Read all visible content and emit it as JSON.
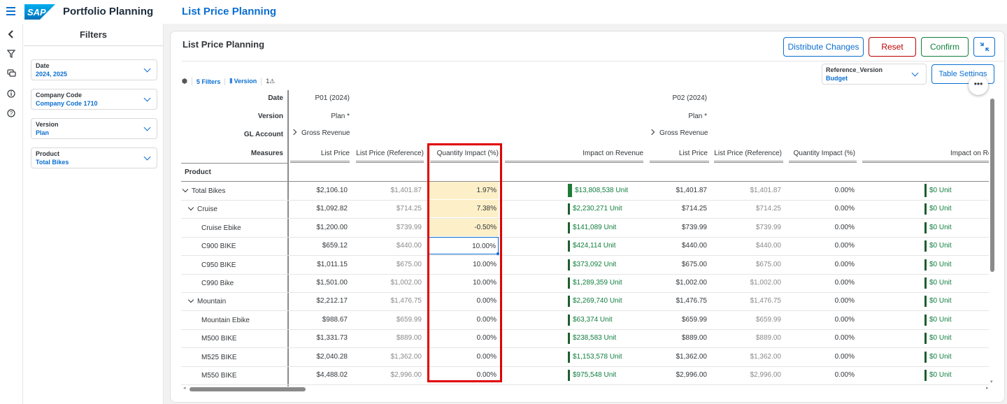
{
  "shell": {
    "app_title": "Portfolio Planning",
    "page_title": "List Price Planning",
    "logo_text": "SAP"
  },
  "rail": {
    "icons": [
      "collapse-icon",
      "filter-icon",
      "comments-icon",
      "info-icon",
      "help-icon"
    ]
  },
  "filters": {
    "title": "Filters",
    "items": [
      {
        "label": "Date",
        "value": "2024, 2025"
      },
      {
        "label": "Company Code",
        "value": "Company Code 1710"
      },
      {
        "label": "Version",
        "value": "Plan"
      },
      {
        "label": "Product",
        "value": "Total Bikes"
      }
    ]
  },
  "card": {
    "title": "List Price Planning",
    "buttons": {
      "distribute": "Distribute Changes",
      "reset": "Reset",
      "confirm": "Confirm",
      "table_settings": "Table Settings"
    },
    "toolbar": {
      "filters": "5 Filters",
      "version": "Version",
      "warnings": "1"
    },
    "reference_version": {
      "label": "Reference_Version",
      "value": "Budget"
    }
  },
  "table": {
    "row_headers": {
      "date": "Date",
      "version": "Version",
      "gl_account": "GL Account",
      "measures": "Measures",
      "product": "Product"
    },
    "periods": [
      {
        "date": "P01 (2024)",
        "version": "Plan *",
        "gl": "Gross Revenue"
      },
      {
        "date": "P02 (2024)",
        "version": "Plan *",
        "gl": "Gross Revenue"
      }
    ],
    "measures": [
      "List Price",
      "List Price (Reference)",
      "Quantity Impact (%)",
      "Impact on Revenue"
    ],
    "measures_p2": [
      "List Price",
      "List Price (Reference)",
      "Quantity Impact (%)",
      "Impact on Reve"
    ],
    "rows": [
      {
        "product": "Total Bikes",
        "level": 0,
        "exp": true,
        "lp": "$2,106.10",
        "ref": "$1,401.87",
        "qi": "1.97%",
        "rev": "$13,808,538 Unit",
        "lp2": "$1,401.87",
        "ref2": "$1,401.87",
        "qi2": "0.00%",
        "rev2": "$0 Unit"
      },
      {
        "product": "Cruise",
        "level": 1,
        "exp": true,
        "lp": "$1,092.82",
        "ref": "$714.25",
        "qi": "7.38%",
        "rev": "$2,230,271 Unit",
        "lp2": "$714.25",
        "ref2": "$714.25",
        "qi2": "0.00%",
        "rev2": "$0 Unit"
      },
      {
        "product": "Cruise Ebike",
        "level": 2,
        "exp": false,
        "lp": "$1,200.00",
        "ref": "$739.99",
        "qi": "-0.50%",
        "rev": "$141,089 Unit",
        "lp2": "$739.99",
        "ref2": "$739.99",
        "qi2": "0.00%",
        "rev2": "$0 Unit"
      },
      {
        "product": "C900 BIKE",
        "level": 2,
        "exp": false,
        "lp": "$659.12",
        "ref": "$440.00",
        "qi": "10.00%",
        "rev": "$424,114 Unit",
        "lp2": "$440.00",
        "ref2": "$440.00",
        "qi2": "0.00%",
        "rev2": "$0 Unit"
      },
      {
        "product": "C950 BIKE",
        "level": 2,
        "exp": false,
        "lp": "$1,011.15",
        "ref": "$675.00",
        "qi": "10.00%",
        "rev": "$373,092 Unit",
        "lp2": "$675.00",
        "ref2": "$675.00",
        "qi2": "0.00%",
        "rev2": "$0 Unit"
      },
      {
        "product": "C990 Bike",
        "level": 2,
        "exp": false,
        "lp": "$1,501.00",
        "ref": "$1,002.00",
        "qi": "10.00%",
        "rev": "$1,289,359 Unit",
        "lp2": "$1,002.00",
        "ref2": "$1,002.00",
        "qi2": "0.00%",
        "rev2": "$0 Unit"
      },
      {
        "product": "Mountain",
        "level": 1,
        "exp": true,
        "lp": "$2,212.17",
        "ref": "$1,476.75",
        "qi": "0.00%",
        "rev": "$2,269,740 Unit",
        "lp2": "$1,476.75",
        "ref2": "$1,476.75",
        "qi2": "0.00%",
        "rev2": "$0 Unit"
      },
      {
        "product": "Mountain Ebike",
        "level": 2,
        "exp": false,
        "lp": "$988.67",
        "ref": "$659.99",
        "qi": "0.00%",
        "rev": "$63,374 Unit",
        "lp2": "$659.99",
        "ref2": "$659.99",
        "qi2": "0.00%",
        "rev2": "$0 Unit"
      },
      {
        "product": "M500 BIKE",
        "level": 2,
        "exp": false,
        "lp": "$1,331.73",
        "ref": "$889.00",
        "qi": "0.00%",
        "rev": "$238,583 Unit",
        "lp2": "$889.00",
        "ref2": "$889.00",
        "qi2": "0.00%",
        "rev2": "$0 Unit"
      },
      {
        "product": "M525 BIKE",
        "level": 2,
        "exp": false,
        "lp": "$2,040.28",
        "ref": "$1,362.00",
        "qi": "0.00%",
        "rev": "$1,153,578 Unit",
        "lp2": "$1,362.00",
        "ref2": "$1,362.00",
        "qi2": "0.00%",
        "rev2": "$0 Unit"
      },
      {
        "product": "M550 BIKE",
        "level": 2,
        "exp": false,
        "lp": "$4,488.02",
        "ref": "$2,996.00",
        "qi": "0.00%",
        "rev": "$975,548 Unit",
        "lp2": "$2,996.00",
        "ref2": "$2,996.00",
        "qi2": "0.00%",
        "rev2": "$0 Unit"
      }
    ],
    "highlighted_rows": [
      0,
      1,
      2
    ],
    "selected_row": 3
  },
  "colors": {
    "accent": "#0a6ed1",
    "reject": "#bb0000",
    "positive": "#107e3e",
    "changed_cell": "#fdf0c8",
    "highlight_box": "#e00000"
  }
}
